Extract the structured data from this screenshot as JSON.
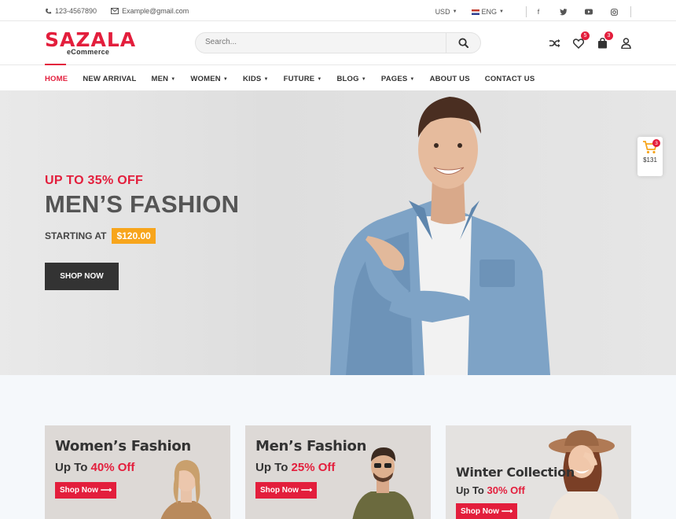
{
  "topbar": {
    "phone": "123-4567890",
    "email": "Example@gmail.com",
    "currency": "USD",
    "language": "ENG",
    "social": [
      "facebook-icon",
      "twitter-icon",
      "youtube-icon",
      "instagram-icon"
    ]
  },
  "header": {
    "logo_name": "SAZALA",
    "logo_tag": "eCommerce",
    "search_placeholder": "Search...",
    "wishlist_count": "5",
    "cart_count": "3"
  },
  "nav": {
    "items": [
      {
        "label": "HOME",
        "active": true,
        "dropdown": false
      },
      {
        "label": "NEW ARRIVAL",
        "dropdown": false
      },
      {
        "label": "MEN",
        "dropdown": true
      },
      {
        "label": "WOMEN",
        "dropdown": true
      },
      {
        "label": "KIDS",
        "dropdown": true
      },
      {
        "label": "FUTURE",
        "dropdown": true
      },
      {
        "label": "BLOG",
        "dropdown": true
      },
      {
        "label": "PAGES",
        "dropdown": true
      },
      {
        "label": "ABOUT US",
        "dropdown": false
      },
      {
        "label": "CONTACT US",
        "dropdown": false
      }
    ]
  },
  "hero": {
    "offer": "UP TO 35% OFF",
    "title": "MEN’S FASHION",
    "starting_label": "STARTING AT",
    "price": "$120.00",
    "button": "SHOP NOW"
  },
  "float_cart": {
    "count": "3",
    "total": "$131"
  },
  "banners": [
    {
      "title": "Women’s Fashion",
      "upto": "Up To",
      "percent": "40% Off",
      "button": "Shop Now"
    },
    {
      "title": "Men’s Fashion",
      "upto": "Up To",
      "percent": "25% Off",
      "button": "Shop Now"
    },
    {
      "title": "Winter Collection",
      "upto": "Up To",
      "percent": "30% Off",
      "button": "Shop Now"
    }
  ],
  "colors": {
    "accent": "#e31e3c",
    "price_badge": "#f7a51c",
    "dark_button": "#333333"
  }
}
